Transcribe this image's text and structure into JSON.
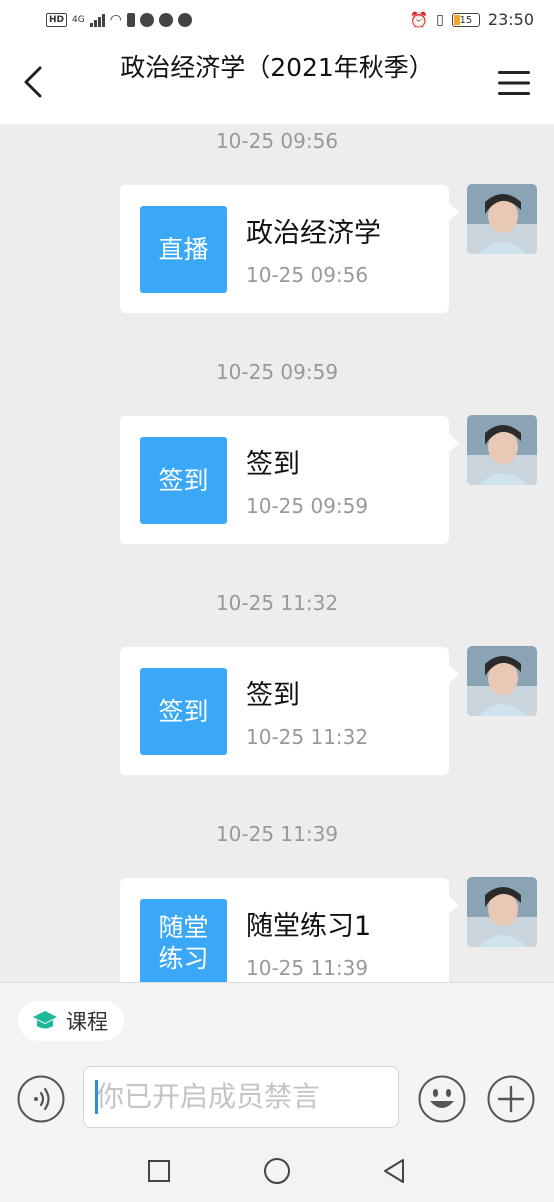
{
  "status_bar": {
    "network_badge": "HD",
    "network_type": "4G",
    "battery": "15",
    "time": "23:50"
  },
  "header": {
    "title": "政治经济学（2021年秋季）"
  },
  "messages": [
    {
      "timestamp": "10-25 09:56",
      "tile_label": "直播",
      "title": "政治经济学",
      "time": "10-25 09:56"
    },
    {
      "timestamp": "10-25 09:59",
      "tile_label": "签到",
      "title": "签到",
      "time": "10-25 09:59"
    },
    {
      "timestamp": "10-25 11:32",
      "tile_label": "签到",
      "title": "签到",
      "time": "10-25 11:32"
    },
    {
      "timestamp": "10-25 11:39",
      "tile_label": "随堂练习",
      "title": "随堂练习1",
      "time": "10-25 11:39"
    }
  ],
  "bottom": {
    "course_chip_label": "课程",
    "input_placeholder": "你已开启成员禁言"
  },
  "colors": {
    "accent": "#3aa8f6",
    "course_icon": "#1fb89a",
    "chat_background": "#ededed"
  }
}
